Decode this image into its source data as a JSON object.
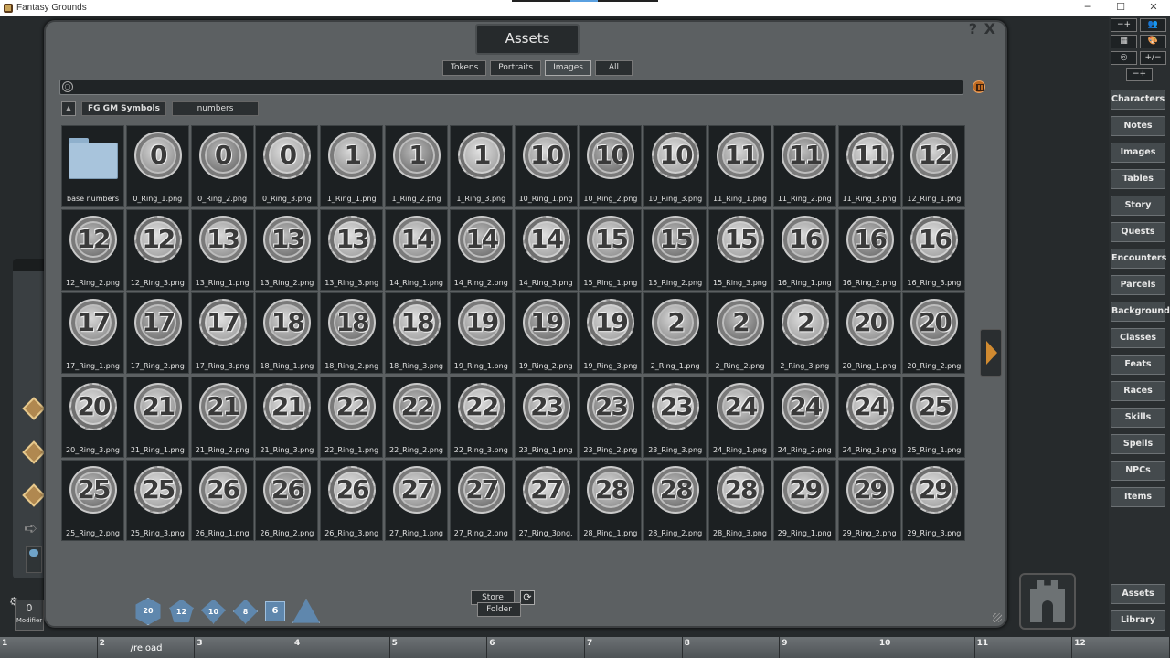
{
  "app": {
    "title": "Fantasy Grounds",
    "win_min": "─",
    "win_max": "☐",
    "win_close": "✕"
  },
  "window": {
    "title": "Assets",
    "help": "?",
    "close": "X"
  },
  "filters": [
    {
      "label": "Tokens",
      "selected": false
    },
    {
      "label": "Portraits",
      "selected": false
    },
    {
      "label": "Images",
      "selected": true
    },
    {
      "label": "All",
      "selected": false
    }
  ],
  "search": {
    "value": "",
    "placeholder": ""
  },
  "breadcrumb": {
    "up": "▲",
    "path1": "FG GM Symbols",
    "path2": "numbers"
  },
  "folder_item": {
    "label": "base numbers"
  },
  "assets": [
    {
      "n": "0",
      "s": 1,
      "label": "0_Ring_1.png"
    },
    {
      "n": "0",
      "s": 2,
      "label": "0_Ring_2.png"
    },
    {
      "n": "0",
      "s": 3,
      "label": "0_Ring_3.png"
    },
    {
      "n": "1",
      "s": 1,
      "label": "1_Ring_1.png"
    },
    {
      "n": "1",
      "s": 2,
      "label": "1_Ring_2.png"
    },
    {
      "n": "1",
      "s": 3,
      "label": "1_Ring_3.png"
    },
    {
      "n": "10",
      "s": 1,
      "label": "10_Ring_1.png"
    },
    {
      "n": "10",
      "s": 2,
      "label": "10_Ring_2.png"
    },
    {
      "n": "10",
      "s": 3,
      "label": "10_Ring_3.png"
    },
    {
      "n": "11",
      "s": 1,
      "label": "11_Ring_1.png"
    },
    {
      "n": "11",
      "s": 2,
      "label": "11_Ring_2.png"
    },
    {
      "n": "11",
      "s": 3,
      "label": "11_Ring_3.png"
    },
    {
      "n": "12",
      "s": 1,
      "label": "12_Ring_1.png"
    },
    {
      "n": "12",
      "s": 2,
      "label": "12_Ring_2.png"
    },
    {
      "n": "12",
      "s": 3,
      "label": "12_Ring_3.png"
    },
    {
      "n": "13",
      "s": 1,
      "label": "13_Ring_1.png"
    },
    {
      "n": "13",
      "s": 2,
      "label": "13_Ring_2.png"
    },
    {
      "n": "13",
      "s": 3,
      "label": "13_Ring_3.png"
    },
    {
      "n": "14",
      "s": 1,
      "label": "14_Ring_1.png"
    },
    {
      "n": "14",
      "s": 2,
      "label": "14_Ring_2.png"
    },
    {
      "n": "14",
      "s": 3,
      "label": "14_Ring_3.png"
    },
    {
      "n": "15",
      "s": 1,
      "label": "15_Ring_1.png"
    },
    {
      "n": "15",
      "s": 2,
      "label": "15_Ring_2.png"
    },
    {
      "n": "15",
      "s": 3,
      "label": "15_Ring_3.png"
    },
    {
      "n": "16",
      "s": 1,
      "label": "16_Ring_1.png"
    },
    {
      "n": "16",
      "s": 2,
      "label": "16_Ring_2.png"
    },
    {
      "n": "16",
      "s": 3,
      "label": "16_Ring_3.png"
    },
    {
      "n": "17",
      "s": 1,
      "label": "17_Ring_1.png"
    },
    {
      "n": "17",
      "s": 2,
      "label": "17_Ring_2.png"
    },
    {
      "n": "17",
      "s": 3,
      "label": "17_Ring_3.png"
    },
    {
      "n": "18",
      "s": 1,
      "label": "18_Ring_1.png"
    },
    {
      "n": "18",
      "s": 2,
      "label": "18_Ring_2.png"
    },
    {
      "n": "18",
      "s": 3,
      "label": "18_Ring_3.png"
    },
    {
      "n": "19",
      "s": 1,
      "label": "19_Ring_1.png"
    },
    {
      "n": "19",
      "s": 2,
      "label": "19_Ring_2.png"
    },
    {
      "n": "19",
      "s": 3,
      "label": "19_Ring_3.png"
    },
    {
      "n": "2",
      "s": 1,
      "label": "2_Ring_1.png"
    },
    {
      "n": "2",
      "s": 2,
      "label": "2_Ring_2.png"
    },
    {
      "n": "2",
      "s": 3,
      "label": "2_Ring_3.png"
    },
    {
      "n": "20",
      "s": 1,
      "label": "20_Ring_1.png"
    },
    {
      "n": "20",
      "s": 2,
      "label": "20_Ring_2.png"
    },
    {
      "n": "20",
      "s": 3,
      "label": "20_Ring_3.png"
    },
    {
      "n": "21",
      "s": 1,
      "label": "21_Ring_1.png"
    },
    {
      "n": "21",
      "s": 2,
      "label": "21_Ring_2.png"
    },
    {
      "n": "21",
      "s": 3,
      "label": "21_Ring_3.png"
    },
    {
      "n": "22",
      "s": 1,
      "label": "22_Ring_1.png"
    },
    {
      "n": "22",
      "s": 2,
      "label": "22_Ring_2.png"
    },
    {
      "n": "22",
      "s": 3,
      "label": "22_Ring_3.png"
    },
    {
      "n": "23",
      "s": 1,
      "label": "23_Ring_1.png"
    },
    {
      "n": "23",
      "s": 2,
      "label": "23_Ring_2.png"
    },
    {
      "n": "23",
      "s": 3,
      "label": "23_Ring_3.png"
    },
    {
      "n": "24",
      "s": 1,
      "label": "24_Ring_1.png"
    },
    {
      "n": "24",
      "s": 2,
      "label": "24_Ring_2.png"
    },
    {
      "n": "24",
      "s": 3,
      "label": "24_Ring_3.png"
    },
    {
      "n": "25",
      "s": 1,
      "label": "25_Ring_1.png"
    },
    {
      "n": "25",
      "s": 2,
      "label": "25_Ring_2.png"
    },
    {
      "n": "25",
      "s": 3,
      "label": "25_Ring_3.png"
    },
    {
      "n": "26",
      "s": 1,
      "label": "26_Ring_1.png"
    },
    {
      "n": "26",
      "s": 2,
      "label": "26_Ring_2.png"
    },
    {
      "n": "26",
      "s": 3,
      "label": "26_Ring_3.png"
    },
    {
      "n": "27",
      "s": 1,
      "label": "27_Ring_1.png"
    },
    {
      "n": "27",
      "s": 2,
      "label": "27_Ring_2.png"
    },
    {
      "n": "27",
      "s": 3,
      "label": "27_Ring_3png."
    },
    {
      "n": "28",
      "s": 1,
      "label": "28_Ring_1.png"
    },
    {
      "n": "28",
      "s": 2,
      "label": "28_Ring_2.png"
    },
    {
      "n": "28",
      "s": 3,
      "label": "28_Ring_3.png"
    },
    {
      "n": "29",
      "s": 1,
      "label": "29_Ring_1.png"
    },
    {
      "n": "29",
      "s": 2,
      "label": "29_Ring_2.png"
    },
    {
      "n": "29",
      "s": 3,
      "label": "29_Ring_3.png"
    }
  ],
  "footer": {
    "store": "Store",
    "folder": "Folder",
    "refresh": "⟳"
  },
  "modifier": {
    "value": "0",
    "label": "Modifier"
  },
  "dice": [
    {
      "type": "d20",
      "label": "20"
    },
    {
      "type": "d12",
      "label": "12"
    },
    {
      "type": "d10",
      "label": "10"
    },
    {
      "type": "d8",
      "label": "8"
    },
    {
      "type": "d6",
      "label": "6"
    },
    {
      "type": "d4",
      "label": ""
    }
  ],
  "tools": [
    [
      "−+",
      "👥"
    ],
    [
      "▦",
      "🎨"
    ],
    [
      "◎",
      "+/−"
    ],
    [
      "−+"
    ]
  ],
  "sidebar": [
    "Characters",
    "Notes",
    "Images",
    "Tables",
    "Story",
    "Quests",
    "Encounters",
    "Parcels",
    "Backgrounds",
    "Classes",
    "Feats",
    "Races",
    "Skills",
    "Spells",
    "NPCs",
    "Items"
  ],
  "sidebar_bottom": [
    "Assets",
    "Library"
  ],
  "hotkeys": [
    {
      "k": "1",
      "v": ""
    },
    {
      "k": "2",
      "v": "/reload"
    },
    {
      "k": "3",
      "v": ""
    },
    {
      "k": "4",
      "v": ""
    },
    {
      "k": "5",
      "v": ""
    },
    {
      "k": "6",
      "v": ""
    },
    {
      "k": "7",
      "v": ""
    },
    {
      "k": "8",
      "v": ""
    },
    {
      "k": "9",
      "v": ""
    },
    {
      "k": "10",
      "v": ""
    },
    {
      "k": "11",
      "v": ""
    },
    {
      "k": "12",
      "v": ""
    }
  ]
}
